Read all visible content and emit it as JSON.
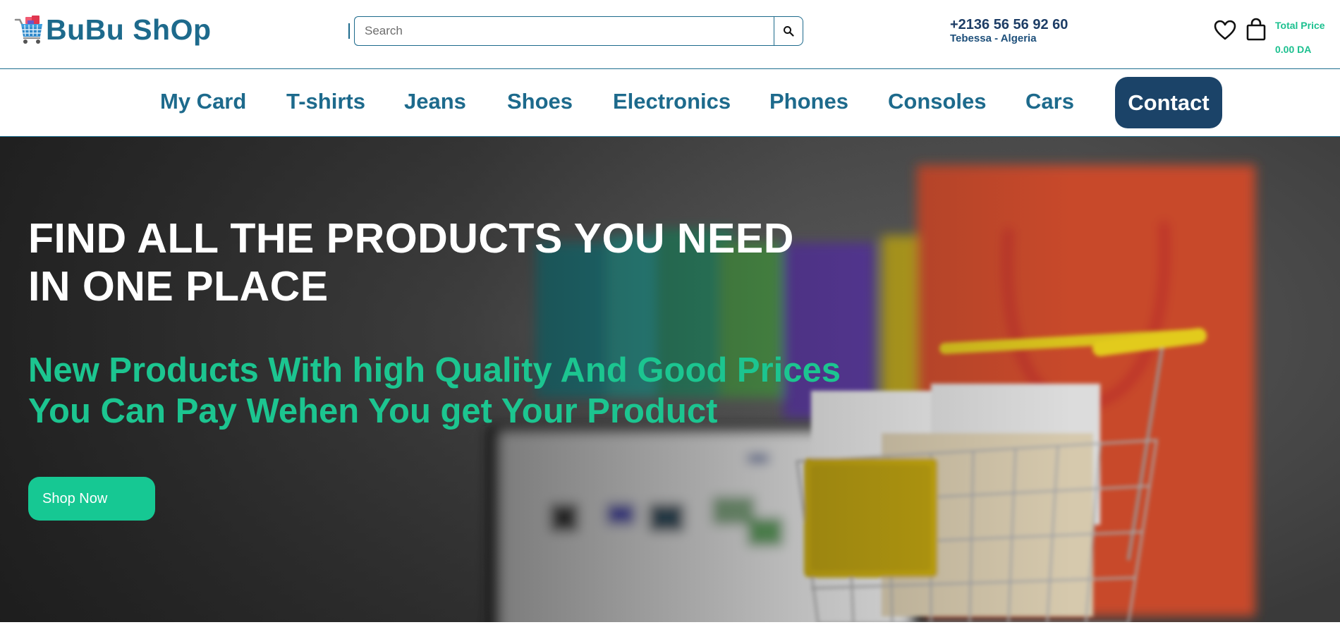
{
  "header": {
    "brand": "BuBu ShOp",
    "search": {
      "placeholder": "Search",
      "value": ""
    },
    "phone": "+2136 56 56 92 60",
    "location": "Tebessa - Algeria",
    "total_label": "Total Price",
    "total_value": "0.00 DA"
  },
  "nav": {
    "items": [
      "My Card",
      "T-shirts",
      "Jeans",
      "Shoes",
      "Electronics",
      "Phones",
      "Consoles",
      "Cars"
    ],
    "contact": "Contact"
  },
  "hero": {
    "title_line1": "FIND ALL THE PRODUCTS YOU NEED",
    "title_line2": "IN ONE PLACE",
    "sub_line1": "New Products With high Quality And Good Prices",
    "sub_line2": "You Can Pay Wehen You get Your Product",
    "cta": "Shop Now"
  },
  "icons": {
    "logo": "shopping-cart-icon",
    "search": "search-icon",
    "wishlist": "heart-icon",
    "cart": "shopping-bag-icon"
  },
  "colors": {
    "primary": "#1d6a8c",
    "accent": "#1cc590",
    "contact_bg": "#1b4368"
  }
}
